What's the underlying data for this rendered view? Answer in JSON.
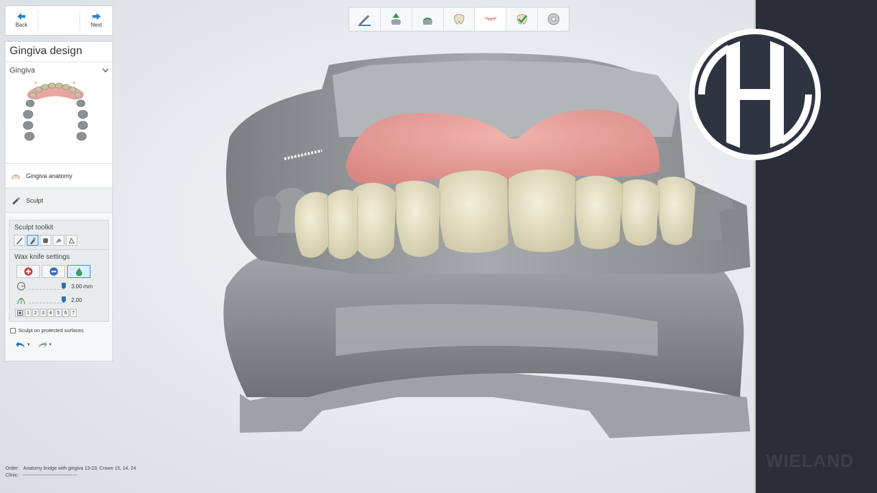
{
  "nav": {
    "back_label": "Back",
    "next_label": "Next"
  },
  "panel": {
    "title": "Gingiva design",
    "gingiva_section_label": "Gingiva",
    "steps": [
      {
        "label": "Gingiva anatomy",
        "icon": "gingiva-anatomy-icon"
      },
      {
        "label": "Sculpt",
        "icon": "sculpt-icon"
      }
    ],
    "toolkit_title": "Sculpt toolkit",
    "wax_title": "Wax knife settings",
    "radius_value": "3.00 mm",
    "strength_value": "2.00",
    "number_buttons": [
      "1",
      "2",
      "3",
      "4",
      "5",
      "6",
      "7"
    ],
    "protected_label": "Sculpt on protected surfaces"
  },
  "footer": {
    "order_label": "Order:",
    "order_value": "Anatomy bridge with gingiva 13-23, Crown 15, 14, 24",
    "clinic_label": "Clinic:",
    "clinic_value": "----------------------------------"
  },
  "brand": {
    "name": "WIELAND"
  },
  "colors": {
    "accent": "#3b8fd8",
    "gingiva": "#e39a96",
    "teeth": "#e6e0c4",
    "model": "#8f9294",
    "side_bar": "#2a2e38"
  }
}
